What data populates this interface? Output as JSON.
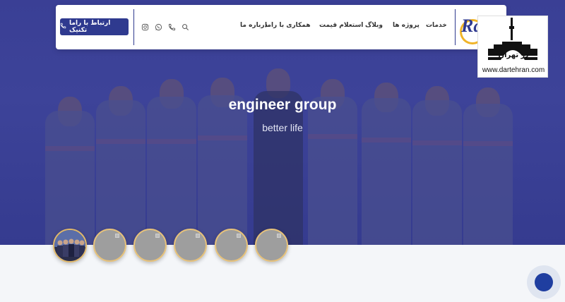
{
  "nav": {
    "cta_label": "ارتباط با راما تکنیک",
    "menu": [
      "خدمات",
      "پروژه ها",
      "وبلاگ",
      "استعلام قیمت",
      "همکاری با راما",
      "درباره ما"
    ],
    "logo_text": "Ra"
  },
  "hero": {
    "title": "engineer group",
    "subtitle": "better life"
  },
  "watermark": {
    "brand": "در تهران",
    "url": "www.dartehran.com"
  },
  "icons": {
    "instagram": "instagram-icon",
    "whatsapp": "whatsapp-icon",
    "phone": "phone-icon",
    "search": "search-icon",
    "cta_phone": "phone-icon"
  },
  "colors": {
    "brand": "#2f3a8f",
    "hero_overlay": "#3a3f95",
    "thumb_border": "#e7c27a",
    "chat": "#1f3ea0"
  },
  "slider": {
    "thumbnail_count": 6,
    "active_index": 0
  }
}
